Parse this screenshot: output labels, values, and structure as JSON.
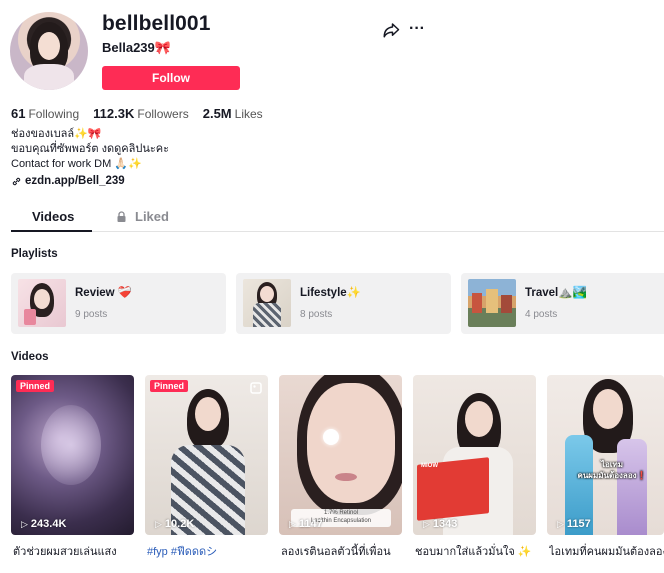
{
  "profile": {
    "username": "bellbell001",
    "nickname": "Bella239🎀",
    "follow_label": "Follow",
    "stats": [
      {
        "value": "61",
        "label": "Following"
      },
      {
        "value": "112.3K",
        "label": "Followers"
      },
      {
        "value": "2.5M",
        "label": "Likes"
      }
    ],
    "bio": [
      "ช่องของเบลล์✨🎀",
      "ขอบคุณที่ซัพพอร์ต งดดูคลิปนะคะ",
      "Contact for work DM 🙏🏻✨"
    ],
    "link": "ezdn.app/Bell_239"
  },
  "tabs": {
    "videos": "Videos",
    "liked": "Liked"
  },
  "sections": {
    "playlists": "Playlists",
    "videos": "Videos"
  },
  "playlists": [
    {
      "name": "Review ❤️‍🩹",
      "count": "9 posts"
    },
    {
      "name": "Lifestyle✨",
      "count": "8 posts"
    },
    {
      "name": "Travel⛰️🏞️",
      "count": "4 posts"
    }
  ],
  "videos": [
    {
      "pinned": "Pinned",
      "views": "243.4K",
      "caption": "ตัวช่วยผมสวยเล่นแสง"
    },
    {
      "pinned": "Pinned",
      "views": "10.2K",
      "caption": "#fyp #ฟีดดดシ"
    },
    {
      "pinned": "",
      "views": "1147",
      "caption": "ลองเรตินอลตัวนี้ที่เพื่อน",
      "overlay": "1.7% Retinol\nLecithin Encapsulation"
    },
    {
      "pinned": "",
      "views": "1343",
      "caption": "ชอบมากใส่แล้วมั่นใจ ✨",
      "overlay": "MIOW"
    },
    {
      "pinned": "",
      "views": "1157",
      "caption": "ไอเทมที่คนผมมันต้องลอง",
      "overlay": "ไอเทม\nคนผมมันต้องลอง❗"
    }
  ],
  "colors": {
    "accent": "#fe2c55",
    "text": "#161823",
    "muted": "#8a8b91",
    "card_bg": "#f1f1f2",
    "hashtag": "#2b5db9"
  },
  "icons": {
    "share": "share-icon",
    "more": "more-icon",
    "link": "link-icon",
    "lock": "lock-icon",
    "play": "play-icon"
  }
}
